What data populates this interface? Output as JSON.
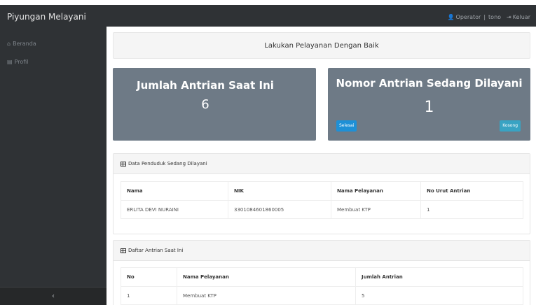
{
  "app": {
    "brand": "Piyungan Melayani",
    "user_label": "Operator",
    "user_separator": "|",
    "username": "tono",
    "logout_label": "Keluar"
  },
  "sidebar": {
    "items": [
      {
        "label": "Beranda",
        "icon": "home-icon"
      },
      {
        "label": "Profil",
        "icon": "book-icon"
      }
    ],
    "collapse_glyph": "‹"
  },
  "main": {
    "welcome": "Lakukan Pelayanan Dengan Baik",
    "stats": {
      "left": {
        "title": "Jumlah Antrian Saat Ini",
        "value": "6"
      },
      "right": {
        "title": "Nomor Antrian Sedang Dilayani",
        "value": "1",
        "done_label": "Selesai",
        "empty_label": "Kosong"
      }
    },
    "current_resident": {
      "heading": "Data Penduduk Sedang Dilayani",
      "columns": [
        "Nama",
        "NIK",
        "Nama Pelayanan",
        "No Urut Antrian"
      ],
      "rows": [
        [
          "ERLITA DEVI NURAINI",
          "3301084601860005",
          "Membuat KTP",
          "1"
        ]
      ]
    },
    "queue_list": {
      "heading": "Daftar Antrian Saat Ini",
      "columns": [
        "No",
        "Nama Pelayanan",
        "Jumlah Antrian"
      ],
      "rows": [
        [
          "1",
          "Membuat KTP",
          "5"
        ]
      ]
    }
  },
  "colors": {
    "topbar": "#2f3235",
    "stat_card": "#6e7a86",
    "btn_done": "#1e90d6",
    "btn_empty": "#39a3c3"
  }
}
